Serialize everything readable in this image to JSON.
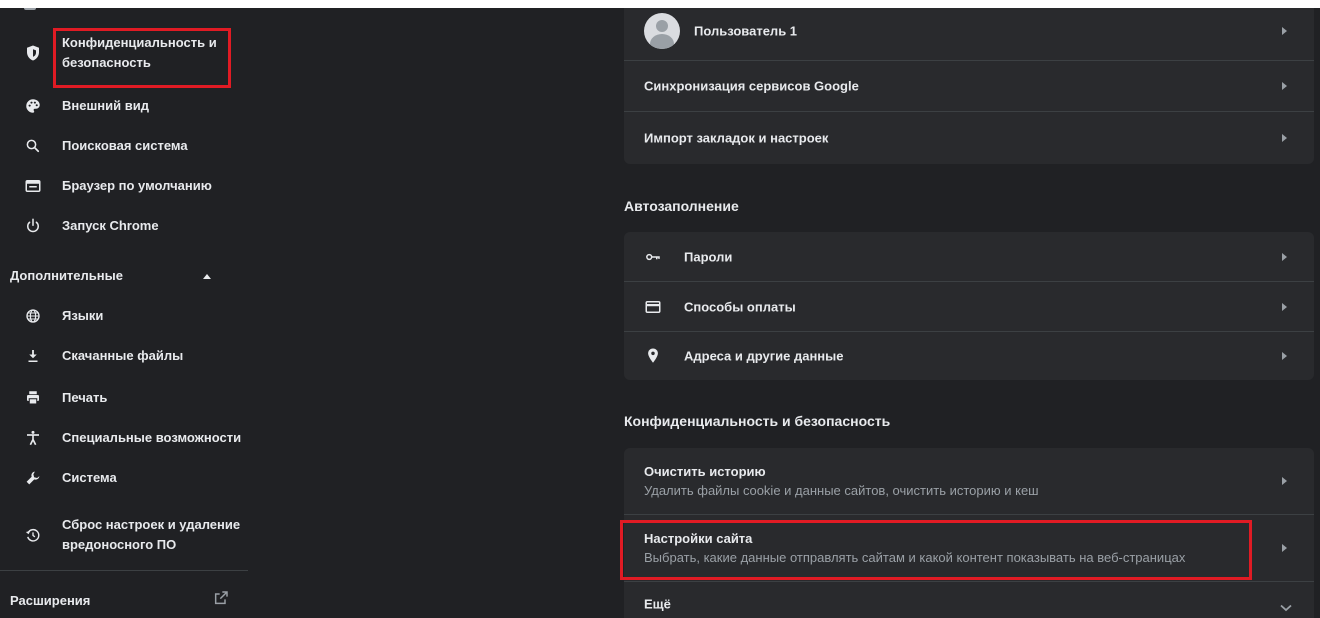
{
  "sidebar": {
    "items": [
      {
        "label": "Конфиденциальность и безопасность",
        "icon": "shield-icon"
      },
      {
        "label": "Внешний вид",
        "icon": "palette-icon"
      },
      {
        "label": "Поисковая система",
        "icon": "search-icon"
      },
      {
        "label": "Браузер по умолчанию",
        "icon": "browser-window-icon"
      },
      {
        "label": "Запуск Chrome",
        "icon": "power-icon"
      }
    ],
    "advanced_label": "Дополнительные",
    "advanced_items": [
      {
        "label": "Языки",
        "icon": "globe-icon"
      },
      {
        "label": "Скачанные файлы",
        "icon": "download-icon"
      },
      {
        "label": "Печать",
        "icon": "printer-icon"
      },
      {
        "label": "Специальные возможности",
        "icon": "accessibility-icon"
      },
      {
        "label": "Система",
        "icon": "wrench-icon"
      },
      {
        "label": "Сброс настроек и удаление вредоносного ПО",
        "icon": "restore-icon"
      }
    ],
    "extensions_label": "Расширения"
  },
  "people_card": {
    "rows": [
      {
        "label": "Пользователь 1"
      },
      {
        "label": "Синхронизация сервисов Google"
      },
      {
        "label": "Импорт закладок и настроек"
      }
    ]
  },
  "autofill": {
    "title": "Автозаполнение",
    "rows": [
      {
        "label": "Пароли",
        "icon": "key-icon"
      },
      {
        "label": "Способы оплаты",
        "icon": "credit-card-icon"
      },
      {
        "label": "Адреса и другие данные",
        "icon": "location-pin-icon"
      }
    ]
  },
  "privacy": {
    "title": "Конфиденциальность и безопасность",
    "rows": [
      {
        "label": "Очистить историю",
        "sublabel": "Удалить файлы cookie и данные сайтов, очистить историю и кеш"
      },
      {
        "label": "Настройки сайта",
        "sublabel": "Выбрать, какие данные отправлять сайтам и какой контент показывать на веб-страницах"
      },
      {
        "label": "Ещё"
      }
    ]
  },
  "colors": {
    "background": "#202124",
    "card": "#292a2d",
    "highlight": "#e01b24",
    "text": "#e8eaed",
    "secondary_text": "#9aa0a6"
  }
}
